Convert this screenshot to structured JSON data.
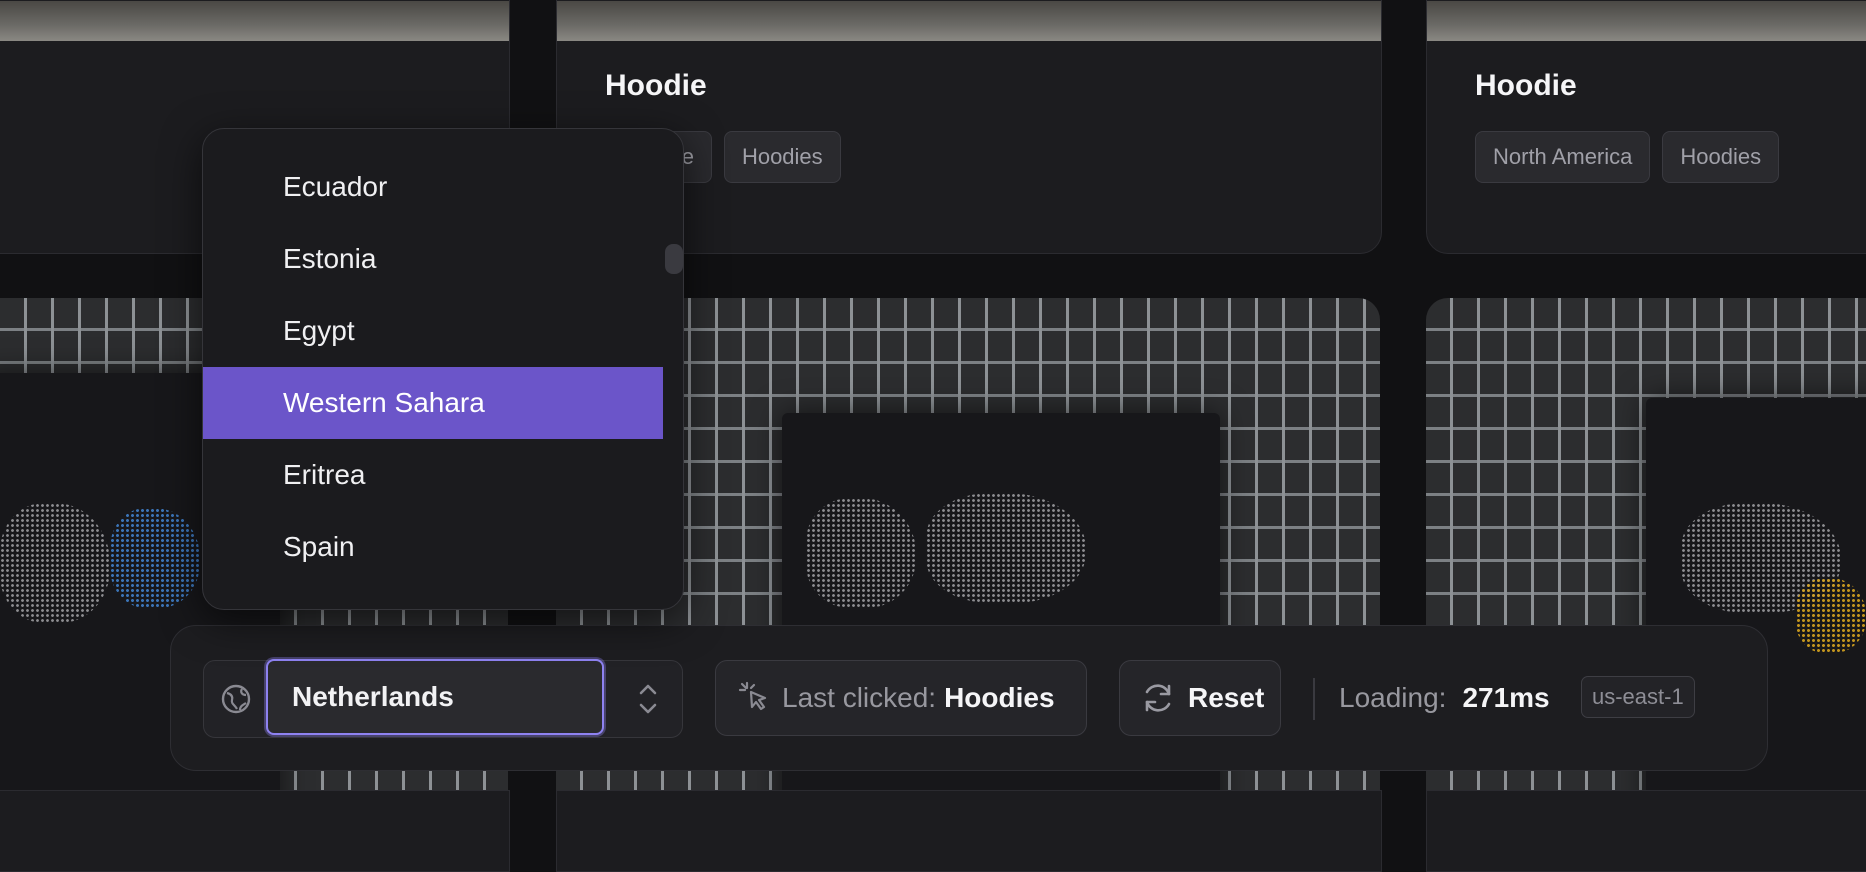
{
  "cards": [
    {
      "title": "",
      "tags": []
    },
    {
      "title": "Hoodie",
      "tags": [
        "Europe",
        "Hoodies"
      ]
    },
    {
      "title": "Hoodie",
      "tags": [
        "North America",
        "Hoodies"
      ]
    }
  ],
  "country_dropdown": {
    "options": [
      "Ecuador",
      "Estonia",
      "Egypt",
      "Western Sahara",
      "Eritrea",
      "Spain"
    ],
    "selected": "Western Sahara"
  },
  "toolbar": {
    "country_value": "Netherlands",
    "last_clicked_label": "Last clicked:",
    "last_clicked_value": "Hoodies",
    "reset_label": "Reset",
    "loading_label": "Loading:",
    "loading_value": "271ms",
    "region": "us-east-1"
  },
  "colors": {
    "accent": "#6b55c9",
    "focus_ring": "#8e82f0",
    "background": "#111113",
    "card": "#1c1c1f"
  },
  "icons": [
    "globe-icon",
    "chevron-updown-icon",
    "pointer-click-icon",
    "refresh-icon"
  ]
}
